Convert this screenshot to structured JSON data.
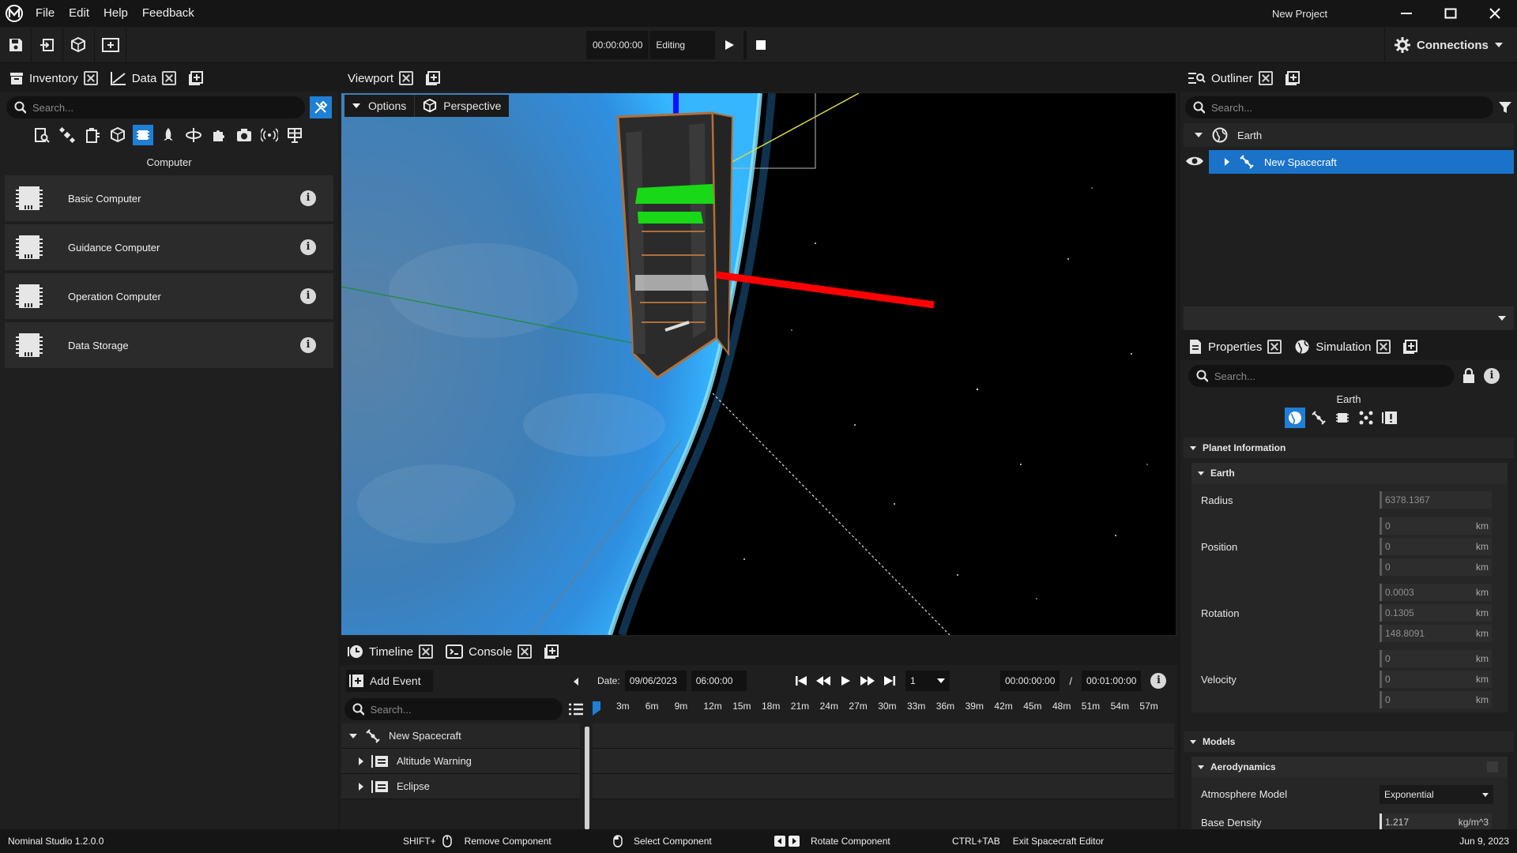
{
  "titlebar": {
    "menu": [
      "File",
      "Edit",
      "Help",
      "Feedback"
    ],
    "project": "New Project"
  },
  "toolbar": {
    "time": "00:00:00:00",
    "mode": "Editing",
    "connections": "Connections"
  },
  "inventory": {
    "tab_inventory": "Inventory",
    "tab_data": "Data",
    "search_placeholder": "Search...",
    "category": "Computer",
    "items": [
      {
        "label": "Basic Computer"
      },
      {
        "label": "Guidance Computer"
      },
      {
        "label": "Operation Computer"
      },
      {
        "label": "Data Storage"
      }
    ]
  },
  "viewport": {
    "tab": "Viewport",
    "options": "Options",
    "perspective": "Perspective"
  },
  "timeline": {
    "tab_timeline": "Timeline",
    "tab_console": "Console",
    "add_event": "Add Event",
    "search_placeholder": "Search...",
    "date_label": "Date:",
    "date": "09/06/2023",
    "time": "06:00:00",
    "step": "1",
    "current": "00:00:00:00",
    "separator": "/",
    "total": "00:01:00:00",
    "ticks": [
      "3m",
      "6m",
      "9m",
      "12m",
      "15m",
      "18m",
      "21m",
      "24m",
      "27m",
      "30m",
      "33m",
      "36m",
      "39m",
      "42m",
      "45m",
      "48m",
      "51m",
      "54m",
      "57m"
    ],
    "tree": {
      "root": "New Spacecraft",
      "children": [
        "Altitude Warning",
        "Eclipse"
      ]
    }
  },
  "outliner": {
    "tab": "Outliner",
    "search_placeholder": "Search...",
    "root": "Earth",
    "child": "New Spacecraft"
  },
  "properties": {
    "tab_properties": "Properties",
    "tab_simulation": "Simulation",
    "search_placeholder": "Search...",
    "object": "Earth",
    "section_planet": "Planet Information",
    "subsection_earth": "Earth",
    "radius_label": "Radius",
    "radius": "6378.1367",
    "position_label": "Position",
    "position": [
      "0",
      "0",
      "0"
    ],
    "rotation_label": "Rotation",
    "rotation": [
      "0.0003",
      "0.1305",
      "148.8091"
    ],
    "velocity_label": "Velocity",
    "velocity": [
      "0",
      "0",
      "0"
    ],
    "unit_km": "km",
    "section_models": "Models",
    "subsection_aero": "Aerodynamics",
    "atmo_label": "Atmosphere Model",
    "atmo_value": "Exponential",
    "base_density_label": "Base Density",
    "base_density": "1.217",
    "base_density_unit": "kg/m^3"
  },
  "statusbar": {
    "version": "Nominal Studio 1.2.0.0",
    "hint1_key": "SHIFT+",
    "hint1": "Remove Component",
    "hint2": "Select Component",
    "hint3": "Rotate Component",
    "hint4_key": "CTRL+TAB",
    "hint4": "Exit Spacecraft Editor",
    "date": "Jun 9, 2023"
  },
  "colors": {
    "accent": "#1f7fd4",
    "selection": "#1a73c9",
    "panel": "#1f1f1f"
  }
}
